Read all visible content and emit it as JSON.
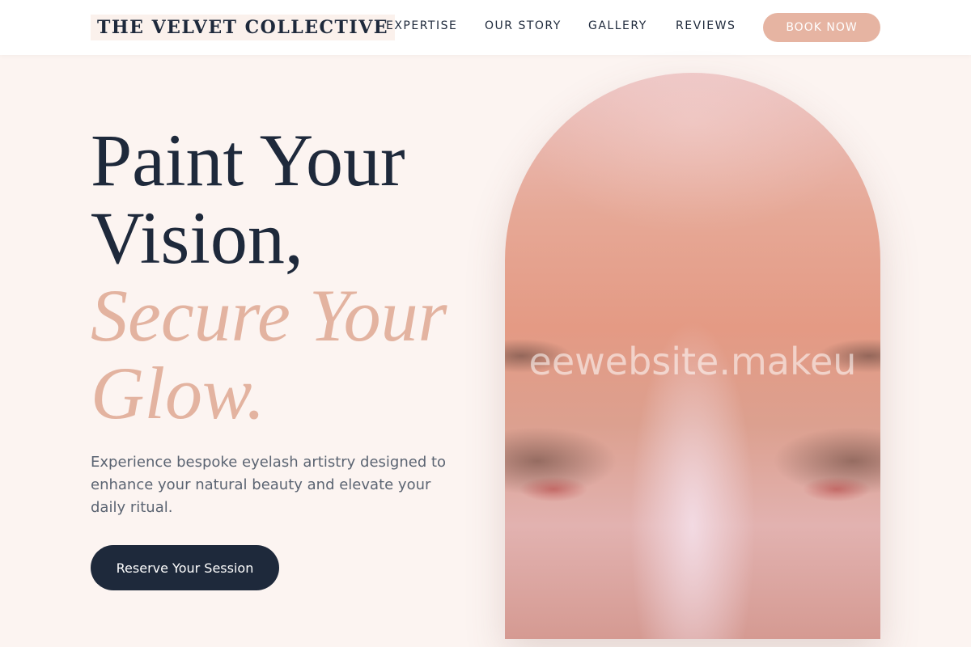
{
  "header": {
    "logo": "THE VELVET COLLECTIVE",
    "nav": [
      "EXPERTISE",
      "OUR STORY",
      "GALLERY",
      "REVIEWS"
    ],
    "book_button": "BOOK NOW"
  },
  "hero": {
    "title_line1": "Paint Your",
    "title_line2": "Vision,",
    "accent_line1": "Secure Your",
    "accent_line2": "Glow.",
    "description": "Experience bespoke eyelash artistry designed to enhance your natural beauty and elevate your daily ritual.",
    "cta_label": "Reserve Your Session",
    "image_watermark": "eewebsite.makeu"
  },
  "colors": {
    "primary": "#1e293b",
    "accent": "#e3b3a0",
    "background": "#fcf4f1",
    "button_pink": "#e6b4a2"
  }
}
